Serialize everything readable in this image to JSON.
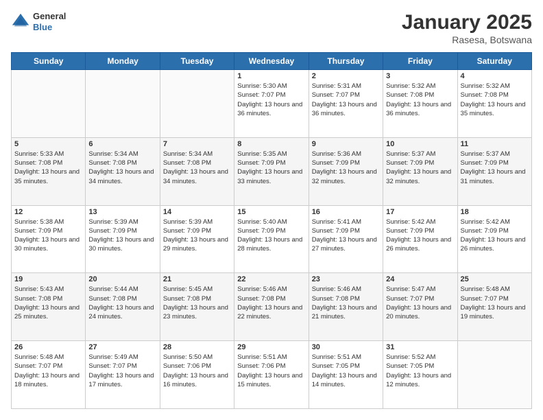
{
  "header": {
    "logo_general": "General",
    "logo_blue": "Blue",
    "month_title": "January 2025",
    "location": "Rasesa, Botswana"
  },
  "days_of_week": [
    "Sunday",
    "Monday",
    "Tuesday",
    "Wednesday",
    "Thursday",
    "Friday",
    "Saturday"
  ],
  "weeks": [
    [
      {
        "day": "",
        "sunrise": "",
        "sunset": "",
        "daylight": ""
      },
      {
        "day": "",
        "sunrise": "",
        "sunset": "",
        "daylight": ""
      },
      {
        "day": "",
        "sunrise": "",
        "sunset": "",
        "daylight": ""
      },
      {
        "day": "1",
        "sunrise": "Sunrise: 5:30 AM",
        "sunset": "Sunset: 7:07 PM",
        "daylight": "Daylight: 13 hours and 36 minutes."
      },
      {
        "day": "2",
        "sunrise": "Sunrise: 5:31 AM",
        "sunset": "Sunset: 7:07 PM",
        "daylight": "Daylight: 13 hours and 36 minutes."
      },
      {
        "day": "3",
        "sunrise": "Sunrise: 5:32 AM",
        "sunset": "Sunset: 7:08 PM",
        "daylight": "Daylight: 13 hours and 36 minutes."
      },
      {
        "day": "4",
        "sunrise": "Sunrise: 5:32 AM",
        "sunset": "Sunset: 7:08 PM",
        "daylight": "Daylight: 13 hours and 35 minutes."
      }
    ],
    [
      {
        "day": "5",
        "sunrise": "Sunrise: 5:33 AM",
        "sunset": "Sunset: 7:08 PM",
        "daylight": "Daylight: 13 hours and 35 minutes."
      },
      {
        "day": "6",
        "sunrise": "Sunrise: 5:34 AM",
        "sunset": "Sunset: 7:08 PM",
        "daylight": "Daylight: 13 hours and 34 minutes."
      },
      {
        "day": "7",
        "sunrise": "Sunrise: 5:34 AM",
        "sunset": "Sunset: 7:08 PM",
        "daylight": "Daylight: 13 hours and 34 minutes."
      },
      {
        "day": "8",
        "sunrise": "Sunrise: 5:35 AM",
        "sunset": "Sunset: 7:09 PM",
        "daylight": "Daylight: 13 hours and 33 minutes."
      },
      {
        "day": "9",
        "sunrise": "Sunrise: 5:36 AM",
        "sunset": "Sunset: 7:09 PM",
        "daylight": "Daylight: 13 hours and 32 minutes."
      },
      {
        "day": "10",
        "sunrise": "Sunrise: 5:37 AM",
        "sunset": "Sunset: 7:09 PM",
        "daylight": "Daylight: 13 hours and 32 minutes."
      },
      {
        "day": "11",
        "sunrise": "Sunrise: 5:37 AM",
        "sunset": "Sunset: 7:09 PM",
        "daylight": "Daylight: 13 hours and 31 minutes."
      }
    ],
    [
      {
        "day": "12",
        "sunrise": "Sunrise: 5:38 AM",
        "sunset": "Sunset: 7:09 PM",
        "daylight": "Daylight: 13 hours and 30 minutes."
      },
      {
        "day": "13",
        "sunrise": "Sunrise: 5:39 AM",
        "sunset": "Sunset: 7:09 PM",
        "daylight": "Daylight: 13 hours and 30 minutes."
      },
      {
        "day": "14",
        "sunrise": "Sunrise: 5:39 AM",
        "sunset": "Sunset: 7:09 PM",
        "daylight": "Daylight: 13 hours and 29 minutes."
      },
      {
        "day": "15",
        "sunrise": "Sunrise: 5:40 AM",
        "sunset": "Sunset: 7:09 PM",
        "daylight": "Daylight: 13 hours and 28 minutes."
      },
      {
        "day": "16",
        "sunrise": "Sunrise: 5:41 AM",
        "sunset": "Sunset: 7:09 PM",
        "daylight": "Daylight: 13 hours and 27 minutes."
      },
      {
        "day": "17",
        "sunrise": "Sunrise: 5:42 AM",
        "sunset": "Sunset: 7:09 PM",
        "daylight": "Daylight: 13 hours and 26 minutes."
      },
      {
        "day": "18",
        "sunrise": "Sunrise: 5:42 AM",
        "sunset": "Sunset: 7:09 PM",
        "daylight": "Daylight: 13 hours and 26 minutes."
      }
    ],
    [
      {
        "day": "19",
        "sunrise": "Sunrise: 5:43 AM",
        "sunset": "Sunset: 7:08 PM",
        "daylight": "Daylight: 13 hours and 25 minutes."
      },
      {
        "day": "20",
        "sunrise": "Sunrise: 5:44 AM",
        "sunset": "Sunset: 7:08 PM",
        "daylight": "Daylight: 13 hours and 24 minutes."
      },
      {
        "day": "21",
        "sunrise": "Sunrise: 5:45 AM",
        "sunset": "Sunset: 7:08 PM",
        "daylight": "Daylight: 13 hours and 23 minutes."
      },
      {
        "day": "22",
        "sunrise": "Sunrise: 5:46 AM",
        "sunset": "Sunset: 7:08 PM",
        "daylight": "Daylight: 13 hours and 22 minutes."
      },
      {
        "day": "23",
        "sunrise": "Sunrise: 5:46 AM",
        "sunset": "Sunset: 7:08 PM",
        "daylight": "Daylight: 13 hours and 21 minutes."
      },
      {
        "day": "24",
        "sunrise": "Sunrise: 5:47 AM",
        "sunset": "Sunset: 7:07 PM",
        "daylight": "Daylight: 13 hours and 20 minutes."
      },
      {
        "day": "25",
        "sunrise": "Sunrise: 5:48 AM",
        "sunset": "Sunset: 7:07 PM",
        "daylight": "Daylight: 13 hours and 19 minutes."
      }
    ],
    [
      {
        "day": "26",
        "sunrise": "Sunrise: 5:48 AM",
        "sunset": "Sunset: 7:07 PM",
        "daylight": "Daylight: 13 hours and 18 minutes."
      },
      {
        "day": "27",
        "sunrise": "Sunrise: 5:49 AM",
        "sunset": "Sunset: 7:07 PM",
        "daylight": "Daylight: 13 hours and 17 minutes."
      },
      {
        "day": "28",
        "sunrise": "Sunrise: 5:50 AM",
        "sunset": "Sunset: 7:06 PM",
        "daylight": "Daylight: 13 hours and 16 minutes."
      },
      {
        "day": "29",
        "sunrise": "Sunrise: 5:51 AM",
        "sunset": "Sunset: 7:06 PM",
        "daylight": "Daylight: 13 hours and 15 minutes."
      },
      {
        "day": "30",
        "sunrise": "Sunrise: 5:51 AM",
        "sunset": "Sunset: 7:05 PM",
        "daylight": "Daylight: 13 hours and 14 minutes."
      },
      {
        "day": "31",
        "sunrise": "Sunrise: 5:52 AM",
        "sunset": "Sunset: 7:05 PM",
        "daylight": "Daylight: 13 hours and 12 minutes."
      },
      {
        "day": "",
        "sunrise": "",
        "sunset": "",
        "daylight": ""
      }
    ]
  ]
}
